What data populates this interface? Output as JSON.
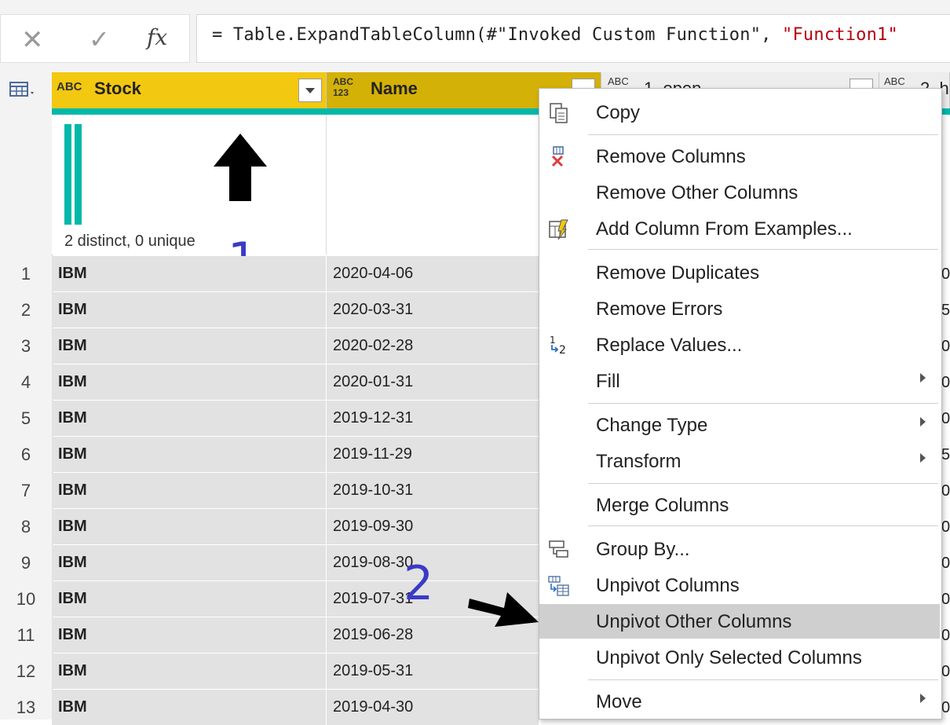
{
  "formula_bar": {
    "cancel_glyph": "✕",
    "confirm_glyph": "✓",
    "fx_glyph": "fx",
    "formula_prefix": "= Table.ExpandTableColumn(#\"Invoked Custom Function\", ",
    "formula_string": "\"Function1\""
  },
  "columns": {
    "stock": {
      "type_icon": "ABC",
      "label": "Stock"
    },
    "name": {
      "type_icon": "ABC\n123",
      "label": "Name"
    },
    "col3": {
      "type_icon": "ABC",
      "label": "1. open"
    },
    "col4": {
      "type_icon": "ABC",
      "label": "2. h"
    }
  },
  "profile": {
    "text": "2 distinct, 0 unique"
  },
  "rows": [
    {
      "n": "1",
      "stock": "IBM",
      "name": "2020-04-06",
      "peek": "0"
    },
    {
      "n": "2",
      "stock": "IBM",
      "name": "2020-03-31",
      "peek": "5"
    },
    {
      "n": "3",
      "stock": "IBM",
      "name": "2020-02-28",
      "peek": "0"
    },
    {
      "n": "4",
      "stock": "IBM",
      "name": "2020-01-31",
      "peek": "0"
    },
    {
      "n": "5",
      "stock": "IBM",
      "name": "2019-12-31",
      "peek": "0"
    },
    {
      "n": "6",
      "stock": "IBM",
      "name": "2019-11-29",
      "peek": "5"
    },
    {
      "n": "7",
      "stock": "IBM",
      "name": "2019-10-31",
      "peek": "0"
    },
    {
      "n": "8",
      "stock": "IBM",
      "name": "2019-09-30",
      "peek": "0"
    },
    {
      "n": "9",
      "stock": "IBM",
      "name": "2019-08-30",
      "peek": "0"
    },
    {
      "n": "10",
      "stock": "IBM",
      "name": "2019-07-31",
      "peek": "0"
    },
    {
      "n": "11",
      "stock": "IBM",
      "name": "2019-06-28",
      "peek": "0"
    },
    {
      "n": "12",
      "stock": "IBM",
      "name": "2019-05-31",
      "peek": "0"
    },
    {
      "n": "13",
      "stock": "IBM",
      "name": "2019-04-30",
      "peek": "0"
    }
  ],
  "context_menu": {
    "items": [
      {
        "label": "Copy",
        "icon": "copy-icon"
      },
      {
        "label": "Remove Columns",
        "icon": "remove-columns-icon"
      },
      {
        "label": "Remove Other Columns",
        "icon": ""
      },
      {
        "label": "Add Column From Examples...",
        "icon": "add-column-examples-icon"
      },
      {
        "label": "Remove Duplicates",
        "icon": ""
      },
      {
        "label": "Remove Errors",
        "icon": ""
      },
      {
        "label": "Replace Values...",
        "icon": "replace-values-icon"
      },
      {
        "label": "Fill",
        "icon": "",
        "submenu": true
      },
      {
        "label": "Change Type",
        "icon": "",
        "submenu": true
      },
      {
        "label": "Transform",
        "icon": "",
        "submenu": true
      },
      {
        "label": "Merge Columns",
        "icon": ""
      },
      {
        "label": "Group By...",
        "icon": "group-by-icon"
      },
      {
        "label": "Unpivot Columns",
        "icon": "unpivot-icon"
      },
      {
        "label": "Unpivot Other Columns",
        "icon": "",
        "highlighted": true
      },
      {
        "label": "Unpivot Only Selected Columns",
        "icon": ""
      },
      {
        "label": "Move",
        "icon": "",
        "submenu": true
      }
    ]
  },
  "annotations": {
    "step1": "1",
    "step2": "2"
  },
  "colors": {
    "stock_header": "#f2c811",
    "name_header": "#d4b106",
    "profile_teal": "#01b8aa",
    "annotation_blue": "#3a3ac8"
  }
}
